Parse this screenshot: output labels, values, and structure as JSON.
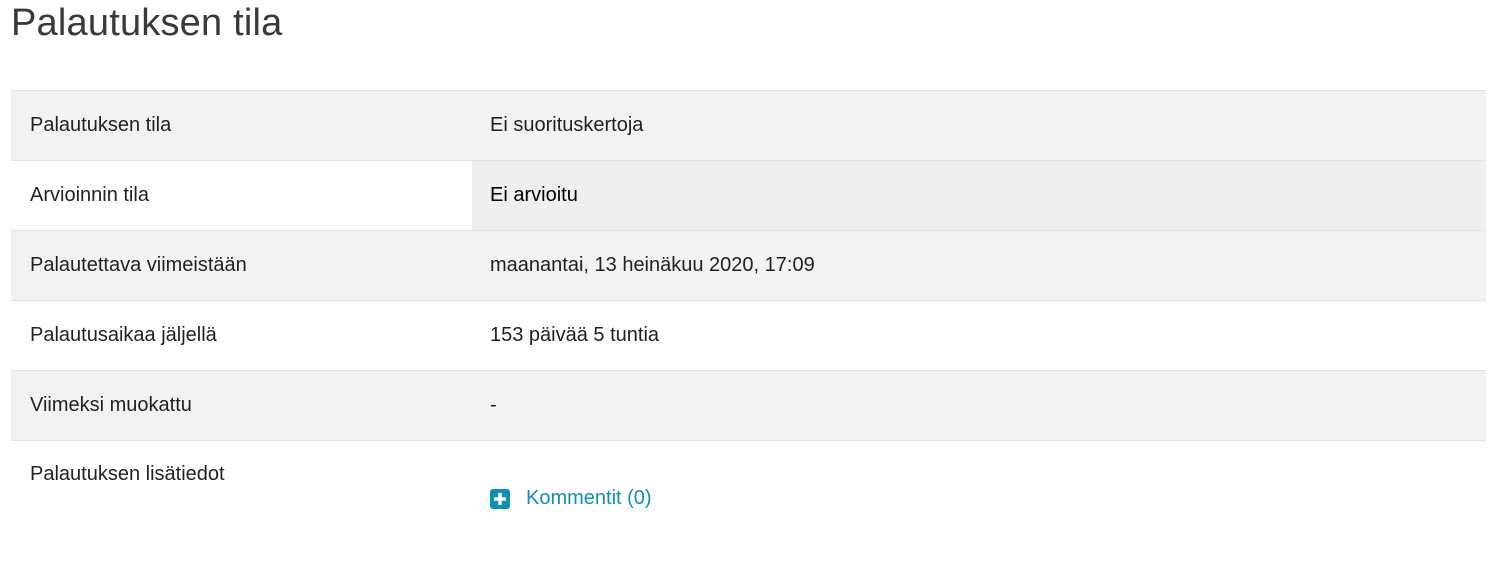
{
  "page": {
    "title": "Palautuksen tila"
  },
  "status_table": {
    "rows": [
      {
        "label": "Palautuksen tila",
        "value": "Ei suorituskertoja"
      },
      {
        "label": "Arvioinnin tila",
        "value": "Ei arvioitu"
      },
      {
        "label": "Palautettava viimeistään",
        "value": "maanantai, 13 heinäkuu 2020, 17:09"
      },
      {
        "label": "Palautusaikaa jäljellä",
        "value": "153 päivää 5 tuntia"
      },
      {
        "label": "Viimeksi muokattu",
        "value": "-"
      },
      {
        "label": "Palautuksen lisätiedot",
        "value": ""
      }
    ]
  },
  "comments": {
    "link_label": "Kommentit (0)",
    "icon": "plus-square-icon",
    "accent_color": "#0f8fb8"
  }
}
